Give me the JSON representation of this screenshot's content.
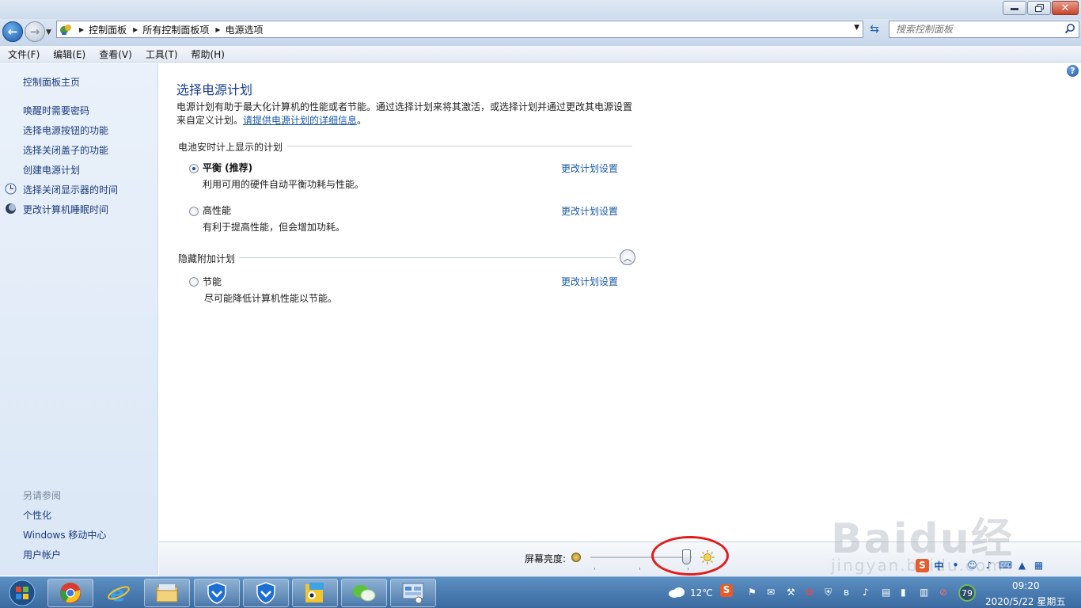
{
  "window": {
    "breadcrumb": [
      "控制面板",
      "所有控制面板项",
      "电源选项"
    ],
    "search_placeholder": "搜索控制面板"
  },
  "menu": [
    "文件(F)",
    "编辑(E)",
    "查看(V)",
    "工具(T)",
    "帮助(H)"
  ],
  "sidebar": {
    "home": "控制面板主页",
    "tasks": [
      {
        "label": "唤醒时需要密码",
        "icon": ""
      },
      {
        "label": "选择电源按钮的功能",
        "icon": ""
      },
      {
        "label": "选择关闭盖子的功能",
        "icon": ""
      },
      {
        "label": "创建电源计划",
        "icon": ""
      },
      {
        "label": "选择关闭显示器的时间",
        "icon": "clock-icon"
      },
      {
        "label": "更改计算机睡眠时间",
        "icon": "moon-icon"
      }
    ],
    "see_also_title": "另请参阅",
    "see_also": [
      "个性化",
      "Windows 移动中心",
      "用户帐户"
    ]
  },
  "main": {
    "title": "选择电源计划",
    "intro_line1": "电源计划有助于最大化计算机的性能或者节能。通过选择计划来将其激活，或选择计划并通过更改其电源设置",
    "intro_line2_prefix": "来自定义计划。",
    "intro_link": "请提供电源计划的详细信息",
    "intro_suffix": "。",
    "battery_group": "电池安时计上显示的计划",
    "hidden_group": "隐藏附加计划",
    "plans": [
      {
        "name": "平衡 (推荐)",
        "desc": "利用可用的硬件自动平衡功耗与性能。",
        "selected": true,
        "link": "更改计划设置"
      },
      {
        "name": "高性能",
        "desc": "有利于提高性能，但会增加功耗。",
        "selected": false,
        "link": "更改计划设置"
      },
      {
        "name": "节能",
        "desc": "尽可能降低计算机性能以节能。",
        "selected": false,
        "link": "更改计划设置"
      }
    ]
  },
  "brightness": {
    "label": "屏幕亮度:",
    "level": 0.95
  },
  "taskbar": {
    "weather": "12℃",
    "time": "09:20",
    "date": "2020/5/22 星期五",
    "battery": "79"
  },
  "watermark": {
    "logo": "Baidu经验",
    "url": "jingyan.baidu.com"
  },
  "colors": {
    "link": "#1a5aa8",
    "title": "#1a3e8c",
    "annotation": "#e21b1b"
  }
}
